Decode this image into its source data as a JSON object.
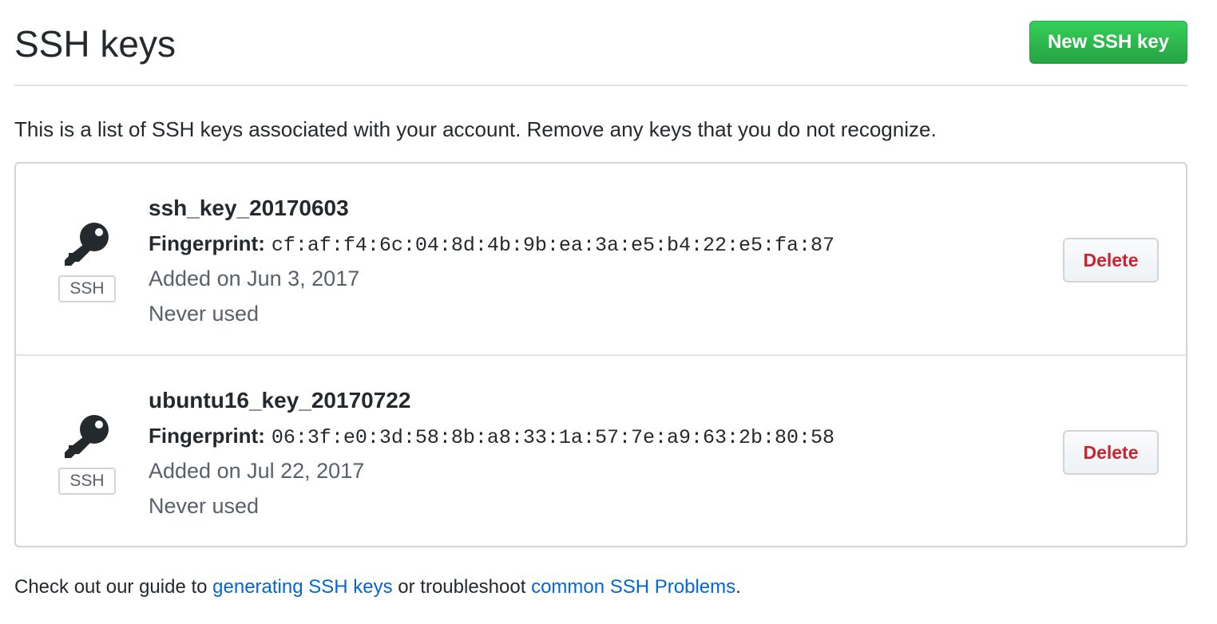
{
  "header": {
    "title": "SSH keys",
    "new_key_label": "New SSH key"
  },
  "description": "This is a list of SSH keys associated with your account. Remove any keys that you do not recognize.",
  "keys": [
    {
      "title": "ssh_key_20170603",
      "fingerprint_label": "Fingerprint:",
      "fingerprint": "cf:af:f4:6c:04:8d:4b:9b:ea:3a:e5:b4:22:e5:fa:87",
      "added": "Added on Jun 3, 2017",
      "last_used": "Never used",
      "type_label": "SSH",
      "icon": "key-icon",
      "delete_label": "Delete"
    },
    {
      "title": "ubuntu16_key_20170722",
      "fingerprint_label": "Fingerprint:",
      "fingerprint": "06:3f:e0:3d:58:8b:a8:33:1a:57:7e:a9:63:2b:80:58",
      "added": "Added on Jul 22, 2017",
      "last_used": "Never used",
      "type_label": "SSH",
      "icon": "key-icon",
      "delete_label": "Delete"
    }
  ],
  "footer": {
    "prefix": "Check out our guide to ",
    "link1": "generating SSH keys",
    "middle": " or troubleshoot ",
    "link2": "common SSH Problems",
    "suffix": "."
  },
  "colors": {
    "accent_green": "#28a745",
    "link_blue": "#0366d6",
    "danger_red": "#cb2431",
    "muted_text": "#586069"
  }
}
